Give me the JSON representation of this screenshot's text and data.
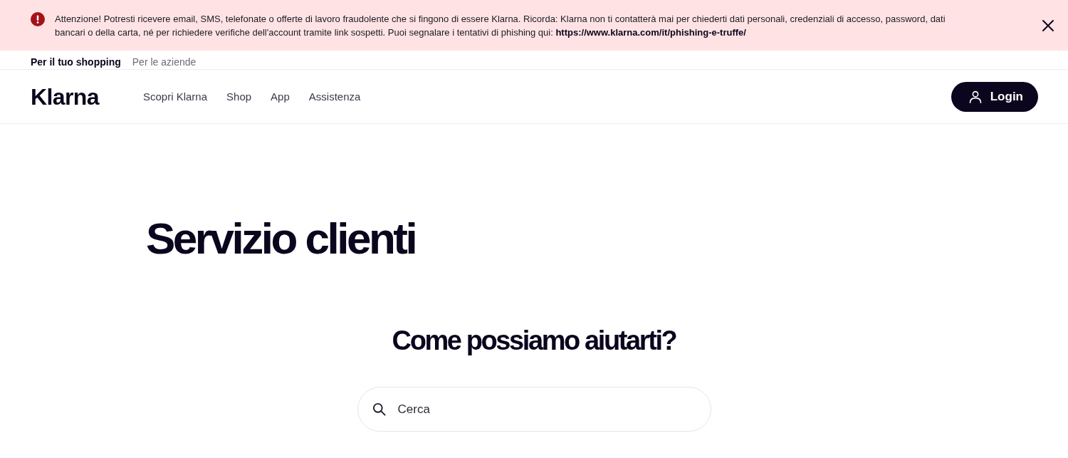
{
  "alert": {
    "message": "Attenzione! Potresti ricevere email, SMS, telefonate o offerte di lavoro fraudolente che si fingono di essere Klarna. Ricorda: Klarna non ti contatterà mai per chiederti dati personali, credenziali di accesso, password, dati bancari o della carta, né per richiedere verifiche dell'account tramite link sospetti. Puoi segnalare i tentativi di phishing qui:",
    "link": "https://www.klarna.com/it/phishing-e-truffe/"
  },
  "audience_tabs": [
    {
      "label": "Per il tuo shopping",
      "selected": true
    },
    {
      "label": "Per le aziende",
      "selected": false
    }
  ],
  "header": {
    "logo": "Klarna",
    "nav": [
      "Scopri Klarna",
      "Shop",
      "App",
      "Assistenza"
    ],
    "login": "Login"
  },
  "hero": {
    "title": "Servizio clienti",
    "subtitle": "Come possiamo aiutarti?",
    "search": {
      "placeholder": "Cerca"
    }
  }
}
